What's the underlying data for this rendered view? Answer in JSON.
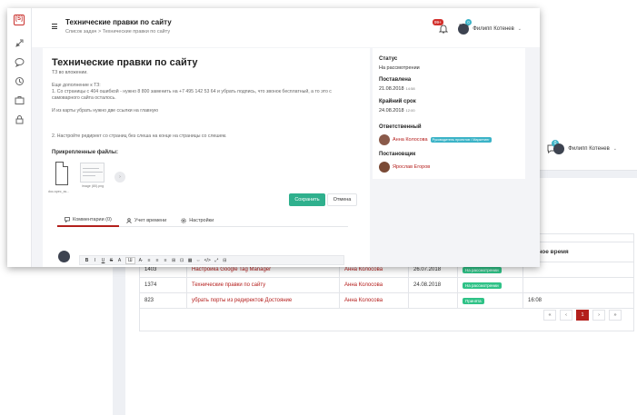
{
  "background": {
    "user_name": "Филипп Котенев",
    "chat_badge": "0",
    "table": {
      "header_partial": "ченное время",
      "rows": [
        {
          "id": "1403",
          "title": "Настройка Google Tag Manager",
          "assignee": "Анна Колосова",
          "date": "26.07.2018",
          "status": "На рассмотрении",
          "time": ""
        },
        {
          "id": "1374",
          "title": "Технические правки по сайту",
          "assignee": "Анна Колосова",
          "date": "24.08.2018",
          "status": "На рассмотрении",
          "time": ""
        },
        {
          "id": "823",
          "title": "убрать порты из редиректов Достояние",
          "assignee": "Анна Колосова",
          "date": "",
          "status": "Принята",
          "time": "16:08"
        }
      ]
    },
    "pager": [
      "«",
      "‹",
      "1",
      "›",
      "»"
    ],
    "pager_active": "1"
  },
  "front": {
    "logo_text": "[S]",
    "header": {
      "title": "Технические правки по сайту",
      "breadcrumb": "Список задач  >  Технические правки по сайту",
      "bell_badge": "99+",
      "chat_badge": "0",
      "user_name": "Филипп Котенев"
    },
    "task": {
      "title": "Технические правки по сайту",
      "description": [
        "ТЗ во вложении.",
        "",
        "Еще дополнение к ТЗ:",
        "1. Со страницы с 404 ошибкой - нужно 8 800 заменить на +7 495 142 53 64 и убрать подпись, что звонок бесплатный, а то это с",
        "самоварного сайта осталось.",
        "",
        "И из карты убрать нужно две ссылки на главную",
        "",
        "",
        "",
        "2.  Настройте редирект со страниц без слеша на конце на страницы со слешем."
      ],
      "files_title": "Прикрепленные файлы:",
      "files": [
        {
          "name": "doc-spec_ss..."
        },
        {
          "name": "image (80).png"
        }
      ],
      "save_label": "Сохранить",
      "cancel_label": "Отмена",
      "tabs": [
        {
          "label": "Комментарии (0)",
          "icon": "comment-icon"
        },
        {
          "label": "Учет времени",
          "icon": "user-icon"
        },
        {
          "label": "Настройки",
          "icon": "gear-icon"
        }
      ],
      "toolbar": [
        "B",
        "I",
        "U",
        "S",
        "A",
        "Ш",
        "A·",
        "≡",
        "≡",
        "≡",
        "⊞",
        "⊡",
        "▦",
        "⇔",
        "</>",
        "⤢",
        "⊟"
      ]
    },
    "side": {
      "status_label": "Статус",
      "status_value": "На рассмотрении",
      "created_label": "Поставлена",
      "created_date": "21.08.2018",
      "created_time": "14:58",
      "deadline_label": "Крайний срок",
      "deadline_date": "24.08.2018",
      "deadline_time": "12:00",
      "responsible_label": "Ответственный",
      "responsible_name": "Анна Колосова",
      "responsible_role": "Руководитель проектов / Маркетинг",
      "author_label": "Постановщик",
      "author_name": "Ярослав Егоров"
    },
    "colors": {
      "accent_red": "#b3201c",
      "accent_green": "#2fb08d",
      "accent_teal": "#3bb3c7"
    }
  }
}
